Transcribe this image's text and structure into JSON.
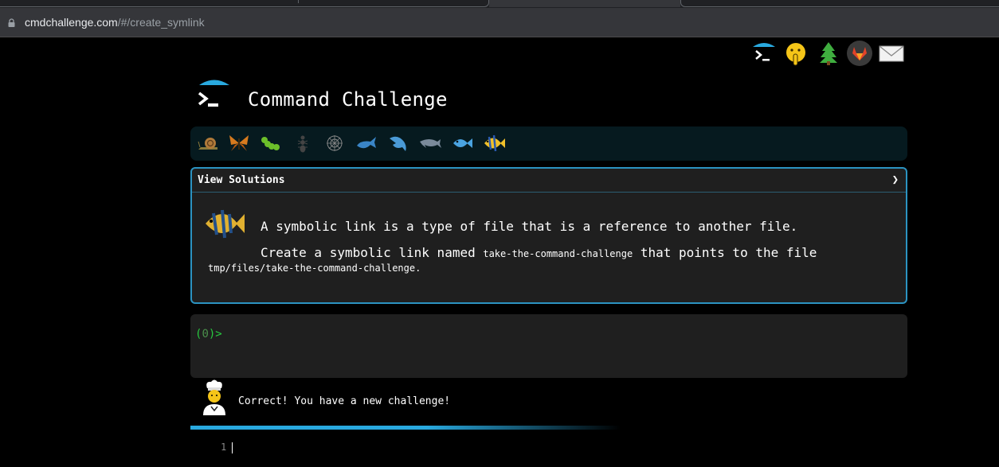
{
  "browser": {
    "url_host": "cmdchallenge.com",
    "url_path": "/#/create_symlink"
  },
  "header": {
    "title": "Command Challenge"
  },
  "top_icons": [
    "terminal-logo-icon",
    "shushing-face-icon",
    "tree-icon",
    "gitlab-icon",
    "envelope-icon"
  ],
  "challenge_icons": [
    "snail-icon",
    "butterfly-icon",
    "caterpillar-icon",
    "ant-icon",
    "spider-web-icon",
    "whale-icon",
    "dolphin-icon",
    "dolphin-icon",
    "fish-icon",
    "tropical-fish-icon"
  ],
  "panel": {
    "header_label": "View Solutions",
    "chevron": "❯",
    "line1": "A symbolic link is a type of file that is a reference to another file.",
    "line2_pre": "Create a symbolic link named ",
    "line2_code": "take-the-command-challenge",
    "line2_post": " that points to the file",
    "line3_code": "tmp/files/take-the-command-challenge",
    "line3_post": "."
  },
  "terminal": {
    "prompt_open": "(",
    "prompt_num": "0",
    "prompt_close": ")>"
  },
  "feedback": {
    "message": "Correct! You have a new challenge!"
  },
  "editor": {
    "line_number": "1"
  },
  "colors": {
    "accent": "#2b93c1",
    "progress": "#29a9df",
    "prompt": "#27c93f",
    "panel_bg": "#1f1f1f",
    "bar_bg": "#061a1f"
  }
}
